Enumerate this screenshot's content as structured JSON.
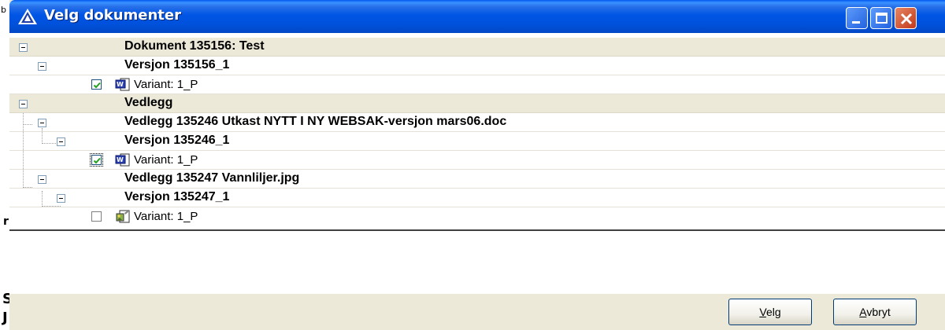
{
  "window": {
    "title": "Velg dokumenter"
  },
  "background_chars": {
    "b": "b",
    "r": "r",
    "s": "S",
    "j": "J"
  },
  "tree": {
    "document_header": "Dokument 135156: Test",
    "doc_version": "Versjon 135156_1",
    "doc_variant": "Variant: 1_P",
    "attachments_header": "Vedlegg",
    "attachment1": "Vedlegg 135246 Utkast NYTT I NY WEBSAK-versjon mars06.doc",
    "attachment1_version": "Versjon 135246_1",
    "attachment1_variant": "Variant: 1_P",
    "attachment2": "Vedlegg 135247 Vannliljer.jpg",
    "attachment2_version": "Versjon 135247_1",
    "attachment2_variant": "Variant: 1_P",
    "checked": {
      "doc_variant": true,
      "attachment1_variant": true,
      "attachment2_variant": false
    }
  },
  "buttons": {
    "velg_first": "V",
    "velg_rest": "elg",
    "avbryt_first": "A",
    "avbryt_rest": "vbryt"
  },
  "colors": {
    "titlebar": "#0055e5",
    "dialog_bg": "#ece9d8",
    "close": "#c4391a"
  },
  "icons": [
    "app-triangle-icon",
    "minimize-icon",
    "maximize-icon",
    "close-icon",
    "word-doc-icon",
    "image-file-icon",
    "checkbox-checked-icon"
  ]
}
